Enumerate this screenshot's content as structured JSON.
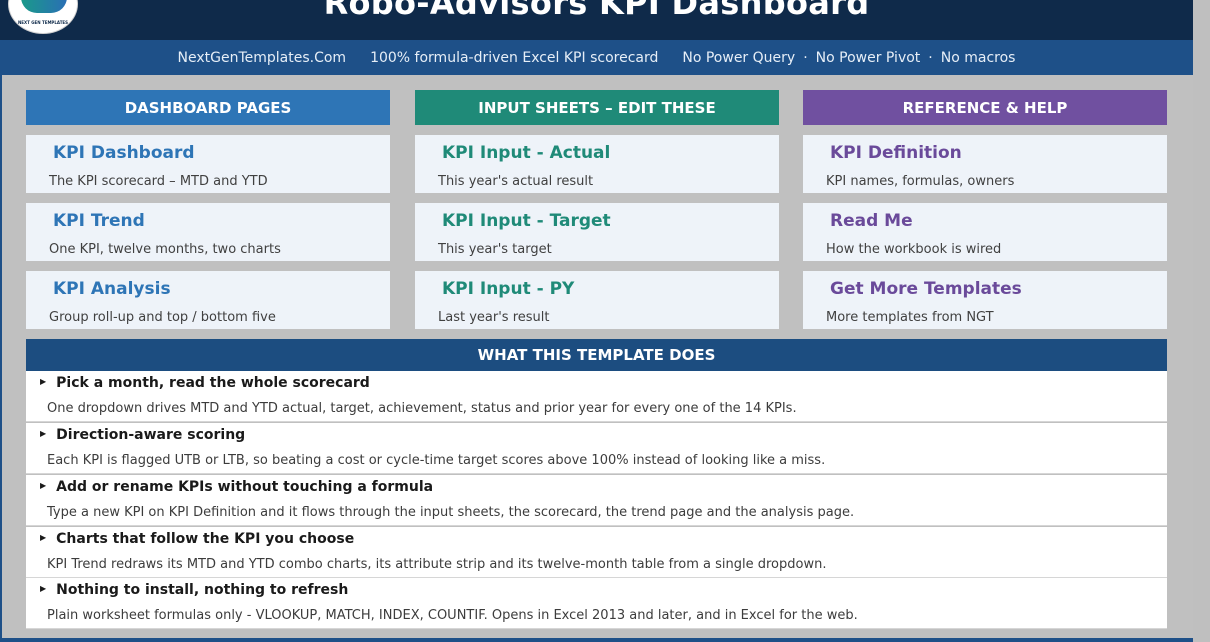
{
  "header": {
    "title": "Robo-Advisors KPI Dashboard",
    "logo_text": "NEXT GEN TEMPLATES"
  },
  "subbar": {
    "site": "NextGenTemplates.Com",
    "tagline": "100% formula-driven Excel KPI scorecard",
    "notes": [
      "No Power Query",
      "No Power Pivot",
      "No macros"
    ],
    "separator": "·"
  },
  "columns": [
    {
      "heading": "DASHBOARD PAGES",
      "color": "#2e75b6",
      "title_color": "#2e75b6",
      "cards": [
        {
          "title": "KPI Dashboard",
          "subtitle": "The KPI scorecard – MTD and YTD"
        },
        {
          "title": "KPI Trend",
          "subtitle": "One KPI, twelve months, two charts"
        },
        {
          "title": "KPI Analysis",
          "subtitle": "Group roll-up and top / bottom five"
        }
      ]
    },
    {
      "heading": "INPUT SHEETS – EDIT THESE",
      "color": "#1f8a78",
      "title_color": "#1f8a78",
      "cards": [
        {
          "title": "KPI Input - Actual",
          "subtitle": "This year's actual result"
        },
        {
          "title": "KPI Input - Target",
          "subtitle": "This year's target"
        },
        {
          "title": "KPI Input - PY",
          "subtitle": "Last year's result"
        }
      ]
    },
    {
      "heading": "REFERENCE & HELP",
      "color": "#7050a0",
      "title_color": "#6a4a9a",
      "cards": [
        {
          "title": "KPI Definition",
          "subtitle": "KPI names, formulas, owners"
        },
        {
          "title": "Read Me",
          "subtitle": "How the workbook is wired"
        },
        {
          "title": "Get More Templates",
          "subtitle": "More templates from NGT"
        }
      ]
    }
  ],
  "what": {
    "heading": "WHAT THIS TEMPLATE DOES",
    "bullet": "▶",
    "items": [
      {
        "title": "Pick a month, read the whole scorecard",
        "desc": "One dropdown drives MTD and YTD actual, target, achievement, status and prior year for every one of the 14 KPIs."
      },
      {
        "title": "Direction-aware scoring",
        "desc": "Each KPI is flagged UTB or LTB, so beating a cost or cycle-time target scores above 100% instead of looking like a miss."
      },
      {
        "title": "Add or rename KPIs without touching a formula",
        "desc": "Type a new KPI on KPI Definition and it flows through the input sheets, the scorecard, the trend page and the analysis page."
      },
      {
        "title": "Charts that follow the KPI you choose",
        "desc": "KPI Trend redraws its MTD and YTD combo charts, its attribute strip and its twelve-month table from a single dropdown."
      },
      {
        "title": "Nothing to install, nothing to refresh",
        "desc": "Plain worksheet formulas only - VLOOKUP, MATCH, INDEX, COUNTIF. Opens in Excel 2013 and later, and in Excel for the web."
      }
    ]
  }
}
